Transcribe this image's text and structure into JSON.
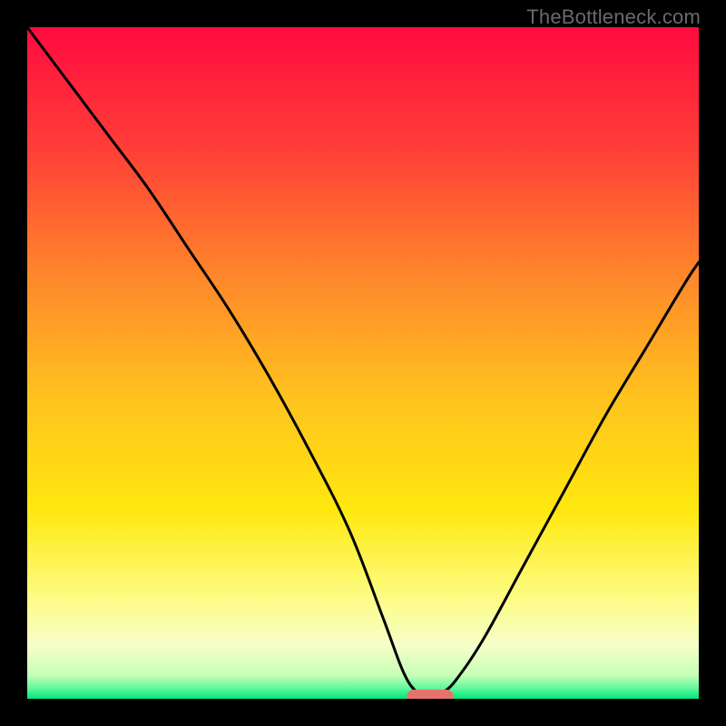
{
  "watermark": {
    "text": "TheBottleneck.com"
  },
  "chart_data": {
    "type": "line",
    "title": "",
    "xlabel": "",
    "ylabel": "",
    "xlim": [
      0,
      100
    ],
    "ylim": [
      0,
      100
    ],
    "grid": false,
    "legend": false,
    "background": {
      "type": "vertical-gradient",
      "stops": [
        {
          "pos": 0.0,
          "color": "#ff0b3f"
        },
        {
          "pos": 0.18,
          "color": "#ff3e37"
        },
        {
          "pos": 0.38,
          "color": "#ff8a2a"
        },
        {
          "pos": 0.55,
          "color": "#ffc21e"
        },
        {
          "pos": 0.72,
          "color": "#ffe80f"
        },
        {
          "pos": 0.85,
          "color": "#fdfc85"
        },
        {
          "pos": 0.92,
          "color": "#f6ffc8"
        },
        {
          "pos": 0.965,
          "color": "#c6ffb8"
        },
        {
          "pos": 0.985,
          "color": "#5cf79a"
        },
        {
          "pos": 1.0,
          "color": "#00e67a"
        }
      ]
    },
    "series": [
      {
        "name": "bottleneck-curve",
        "color": "#000000",
        "x": [
          0,
          6,
          12,
          18,
          24,
          30,
          36,
          42,
          48,
          53,
          56,
          58,
          60,
          62,
          64,
          68,
          74,
          80,
          86,
          92,
          98,
          100
        ],
        "y": [
          100,
          92,
          84,
          76,
          67,
          58,
          48,
          37,
          25,
          12,
          4,
          1,
          0,
          1,
          3,
          9,
          20,
          31,
          42,
          52,
          62,
          65
        ]
      }
    ],
    "marker": {
      "name": "optimal-range",
      "shape": "capsule",
      "x_center": 60,
      "y": 0,
      "width": 7,
      "height": 2.2,
      "color": "#e4736f"
    }
  }
}
